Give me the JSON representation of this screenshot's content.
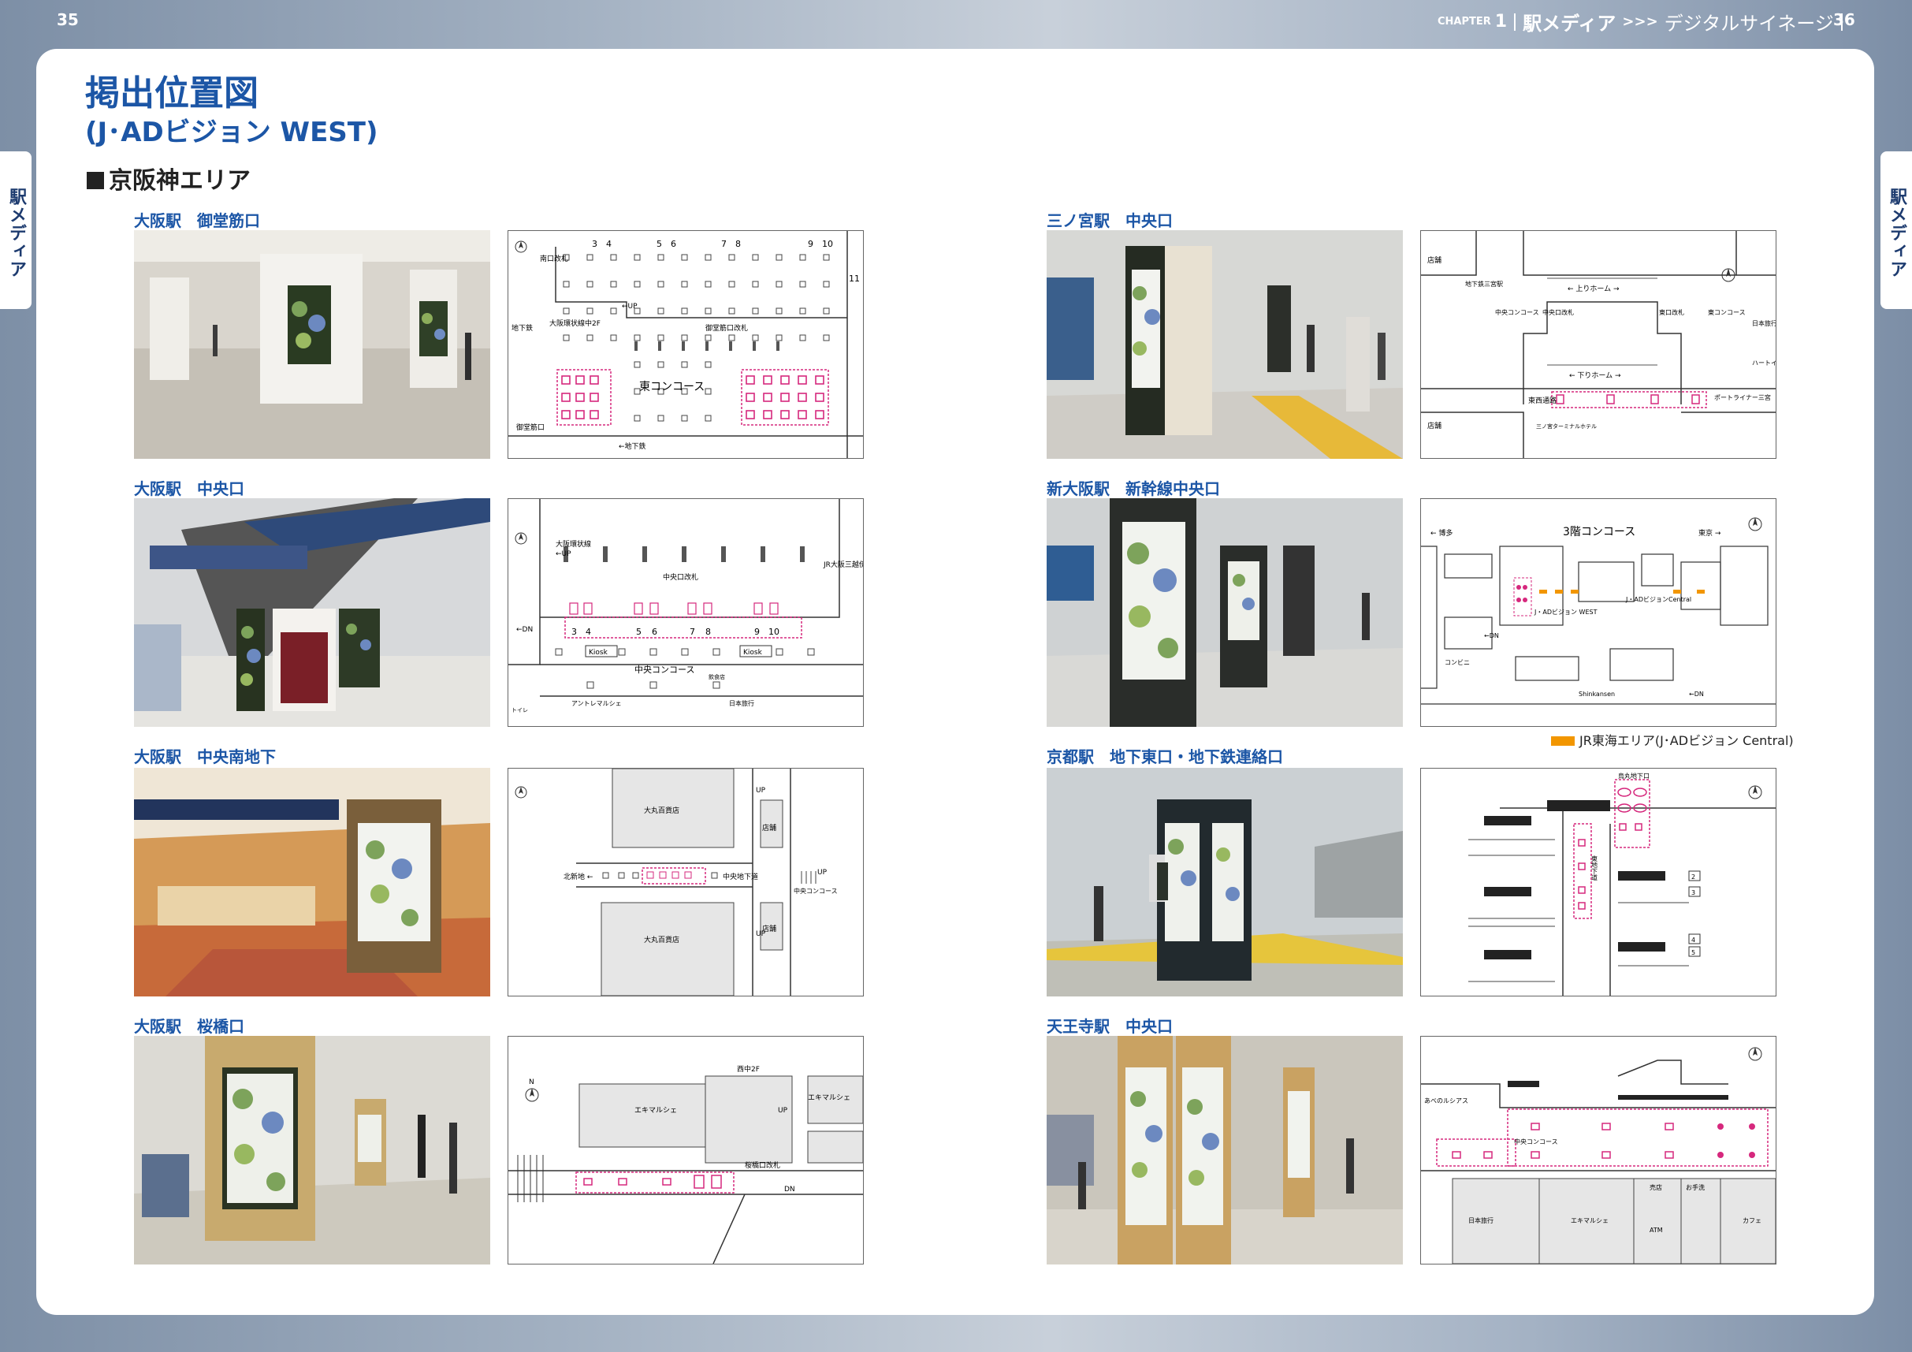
{
  "header": {
    "page_left": "35",
    "page_right": "36",
    "chapter_word": "CHAPTER",
    "chapter_num": "1",
    "section": "駅メディア",
    "arrow": ">>>",
    "subsection": "デジタルサイネージ"
  },
  "side_tabs": {
    "left": "駅メディア",
    "right": "駅メディア"
  },
  "title": "掲出位置図",
  "subtitle": "(J･ADビジョン WEST)",
  "region": "京阪神エリア",
  "locations": [
    {
      "caption": "大阪駅　御堂筋口",
      "map_labels": {
        "numbers": [
          "3",
          "4",
          "5",
          "6",
          "7",
          "8",
          "9",
          "10",
          "11"
        ],
        "minami": "南口改札",
        "up": "←UP",
        "loop": "大阪環状線中2F",
        "underground": "地下鉄",
        "midosuji_gate": "御堂筋口改札",
        "concourse": "東コンコース",
        "midosuji": "御堂筋口",
        "subway_arrow": "←地下鉄"
      }
    },
    {
      "caption": "大阪駅　中央口",
      "map_labels": {
        "loop": "大阪環状線",
        "up": "←UP",
        "jr_sanban": "JR大阪三越伊勢丹",
        "central_gate": "中央口改札",
        "numbers": [
          "3",
          "4",
          "5",
          "6",
          "7",
          "8",
          "9",
          "10"
        ],
        "dn": "←DN",
        "kiosk1": "Kiosk",
        "kiosk2": "Kiosk",
        "concourse": "中央コンコース",
        "shop": "飲食店",
        "toilet": "トイレ",
        "antre": "アントレマルシェ",
        "travel": "日本旅行"
      }
    },
    {
      "caption": "大阪駅　中央南地下",
      "map_labels": {
        "daimaru_top": "大丸百貨店",
        "daimaru_bottom": "大丸百貨店",
        "shop_top": "店舗",
        "shop_bottom": "店舗",
        "up_top": "UP",
        "up_bottom": "UP",
        "kitashinchi": "北新地 ←",
        "central_passage": "中央地下道",
        "up_right": "UP",
        "central_concourse": "中央コンコース"
      }
    },
    {
      "caption": "大阪駅　桜橋口",
      "map_labels": {
        "nishi": "西中2F",
        "ekimarche_left": "エキマルシェ",
        "ekimarche_right": "エキマルシェ",
        "up": "UP",
        "sakurabashi": "桜橋口改札",
        "dn": "DN"
      }
    },
    {
      "caption": "三ノ宮駅　中央口",
      "map_labels": {
        "shop_tl": "店舗",
        "subway": "地下鉄三宮駅",
        "nobori": "← 上りホーム →",
        "chuo_conc": "中央コンコース",
        "chuo_gate": "中央口改札",
        "east_gate": "東口改札",
        "east_conc": "東コンコース",
        "kudari": "← 下りホーム →",
        "travel": "日本旅行",
        "heart": "ハートイン",
        "tozai": "東西通路",
        "portliner": "ポートライナー三宮",
        "shop_bl": "店舗",
        "terminal": "三ノ宮ターミナルホテル"
      }
    },
    {
      "caption": "新大阪駅　新幹線中央口",
      "map_labels": {
        "title": "3階コンコース",
        "hakata": "← 博多",
        "tokyo": "東京 →",
        "west": "J・ADビジョン WEST",
        "central": "J・ADビジョンCentral",
        "dn": "←DN",
        "dn2": "←DN",
        "conbini": "コンビニ",
        "bus": "Shinkansen"
      }
    },
    {
      "caption": "京都駅　地下東口・地下鉄連絡口",
      "map_labels": {
        "exit": "烏丸地下口",
        "passage": "東地下道",
        "nums": [
          "2",
          "3",
          "4",
          "5"
        ]
      }
    },
    {
      "caption": "天王寺駅　中央口",
      "map_labels": {
        "miyako": "あべのルシアス",
        "concourse": "中央コンコース",
        "travel": "日本旅行",
        "ekimarche": "エキマルシェ",
        "atm": "ATM",
        "cafe": "カフェ",
        "kiosk": "売店",
        "toilet": "お手洗"
      }
    }
  ],
  "legend": "JR東海エリア(J･ADビジョン Central)",
  "colors": {
    "accent": "#1c56a6",
    "pink": "#d6287d",
    "orange": "#f29600",
    "map_block": "#e6e6e6"
  },
  "icons": [
    "north-arrow-icon"
  ]
}
